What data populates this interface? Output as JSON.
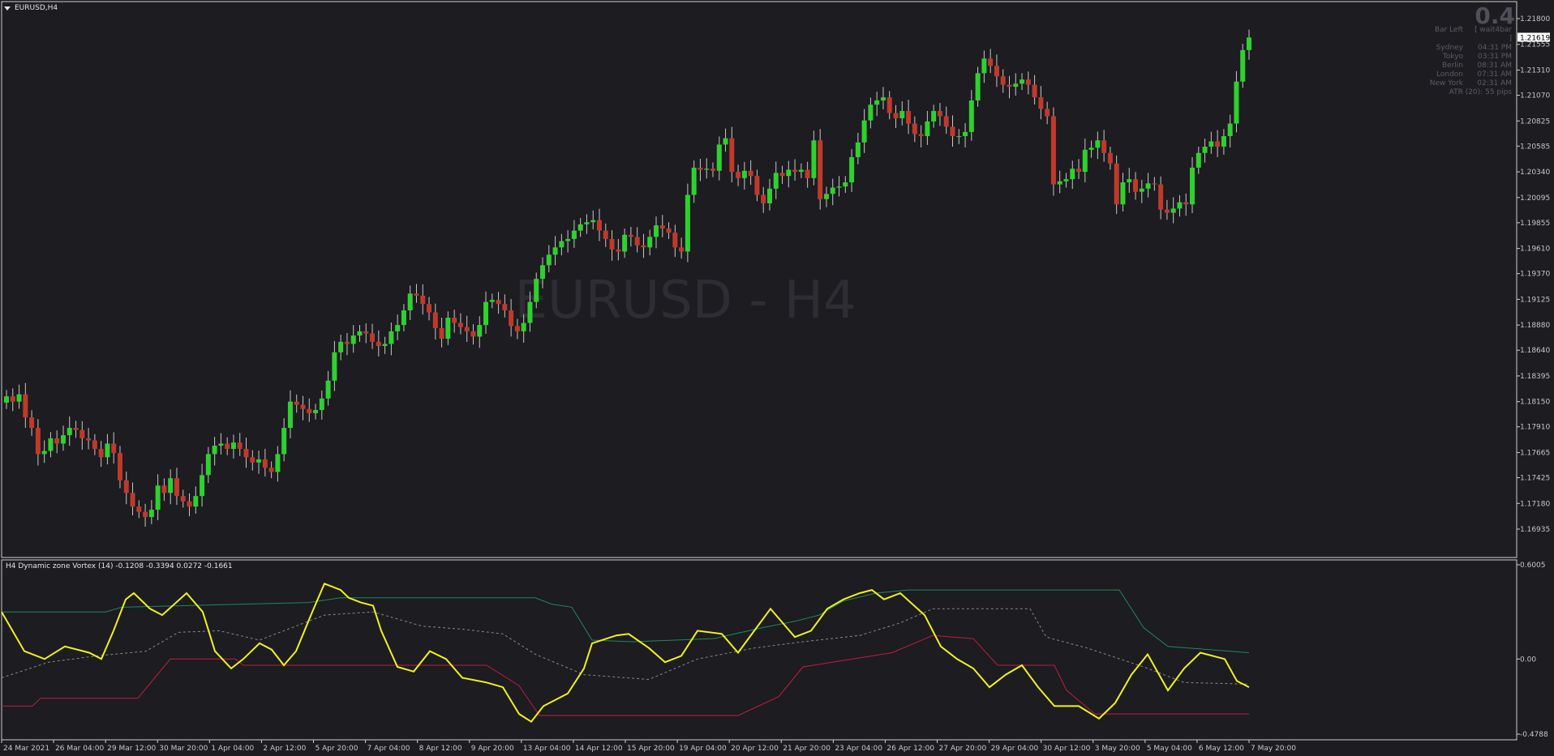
{
  "window": {
    "symbol_title": "EURUSD,H4",
    "watermark": "EURUSD - H4"
  },
  "indicator": {
    "title": "H4 Dynamic zone Vortex (14) -0.1208 -0.3394 0.0272 -0.1661"
  },
  "info_panel": {
    "big_value": "0.4",
    "rows": [
      {
        "label": "Bar Left",
        "value": "[ wait4bar ]"
      },
      {
        "label": "Sydney",
        "value": "04:31 PM"
      },
      {
        "label": "Tokyo",
        "value": "03:31 PM"
      },
      {
        "label": "Berlin",
        "value": "08:31 AM"
      },
      {
        "label": "London",
        "value": "07:31 AM"
      },
      {
        "label": "New York",
        "value": "02:31 AM"
      }
    ],
    "atr": "ATR (20): 55 pips"
  },
  "colors": {
    "background": "#1c1c21",
    "bull": "#2ed12e",
    "bear": "#c0392b",
    "vortex": "#f2f21c",
    "upper": "#1f8a5a",
    "lower": "#c21d3a",
    "mid": "#8a8a8a",
    "axis_text": "#c8c8c8"
  },
  "chart_data": [
    {
      "type": "candlestick",
      "title": "EURUSD,H4",
      "current_price_label": "1.21619",
      "y_ticks": [
        "1.21800",
        "1.21555",
        "1.21310",
        "1.21070",
        "1.20825",
        "1.20585",
        "1.20340",
        "1.20095",
        "1.19855",
        "1.19610",
        "1.19370",
        "1.19125",
        "1.18880",
        "1.18640",
        "1.18395",
        "1.18150",
        "1.17910",
        "1.17665",
        "1.17425",
        "1.17180",
        "1.16935"
      ],
      "ylim": [
        1.16935,
        1.218
      ],
      "x_ticks": [
        "24 Mar 2021",
        "26 Mar 04:00",
        "29 Mar 12:00",
        "30 Mar 20:00",
        "1 Apr 04:00",
        "2 Apr 12:00",
        "5 Apr 20:00",
        "7 Apr 04:00",
        "8 Apr 12:00",
        "9 Apr 20:00",
        "13 Apr 04:00",
        "14 Apr 12:00",
        "15 Apr 20:00",
        "19 Apr 04:00",
        "20 Apr 12:00",
        "21 Apr 20:00",
        "23 Apr 04:00",
        "26 Apr 12:00",
        "27 Apr 20:00",
        "29 Apr 04:00",
        "30 Apr 12:00",
        "3 May 20:00",
        "5 May 04:00",
        "6 May 12:00",
        "7 May 20:00"
      ],
      "close_path": [
        1.182,
        1.1815,
        1.1822,
        1.18,
        1.179,
        1.1765,
        1.1768,
        1.178,
        1.1775,
        1.1783,
        1.179,
        1.1788,
        1.178,
        1.1778,
        1.177,
        1.1762,
        1.1775,
        1.1766,
        1.174,
        1.1728,
        1.1715,
        1.171,
        1.1705,
        1.1712,
        1.1735,
        1.1728,
        1.1742,
        1.1725,
        1.172,
        1.1715,
        1.1725,
        1.1745,
        1.1765,
        1.1773,
        1.1775,
        1.177,
        1.1776,
        1.177,
        1.1762,
        1.1757,
        1.176,
        1.1752,
        1.1748,
        1.1765,
        1.179,
        1.1815,
        1.1812,
        1.1808,
        1.1804,
        1.1807,
        1.1818,
        1.1835,
        1.1862,
        1.1872,
        1.187,
        1.1878,
        1.1882,
        1.188,
        1.1872,
        1.1868,
        1.187,
        1.1882,
        1.1888,
        1.1902,
        1.1918,
        1.1916,
        1.1908,
        1.19,
        1.1885,
        1.1875,
        1.1895,
        1.189,
        1.1886,
        1.1882,
        1.1877,
        1.1888,
        1.191,
        1.1912,
        1.1908,
        1.1902,
        1.1887,
        1.1882,
        1.189,
        1.191,
        1.1932,
        1.1945,
        1.1955,
        1.1962,
        1.1968,
        1.197,
        1.1978,
        1.1984,
        1.1986,
        1.1988,
        1.1978,
        1.197,
        1.196,
        1.1958,
        1.1974,
        1.1972,
        1.1964,
        1.1962,
        1.1972,
        1.1983,
        1.198,
        1.1976,
        1.1962,
        1.1958,
        1.2012,
        1.2038,
        1.2036,
        1.2037,
        1.2035,
        1.206,
        1.2066,
        1.2034,
        1.2028,
        1.2035,
        1.203,
        1.2012,
        1.2004,
        1.2018,
        1.2033,
        1.203,
        1.2036,
        1.2034,
        1.2036,
        1.2028,
        1.2064,
        1.2008,
        1.2013,
        1.2019,
        1.202,
        1.2024,
        1.2048,
        1.2062,
        1.2083,
        1.2098,
        1.2102,
        1.2105,
        1.209,
        1.2085,
        1.2092,
        1.208,
        1.207,
        1.2068,
        1.2082,
        1.2092,
        1.2087,
        1.2077,
        1.2068,
        1.2068,
        1.2072,
        1.2102,
        1.2128,
        1.2142,
        1.2135,
        1.2125,
        1.2117,
        1.2115,
        1.2118,
        1.2122,
        1.2117,
        1.2105,
        1.2094,
        1.2087,
        1.2022,
        1.2025,
        1.2027,
        1.2037,
        1.2034,
        1.2055,
        1.2057,
        1.2064,
        1.2052,
        1.2042,
        1.2003,
        1.2024,
        1.2027,
        1.2015,
        1.2018,
        1.2023,
        1.2022,
        1.1998,
        1.1995,
        1.1999,
        1.2005,
        1.2003,
        1.2038,
        1.2052,
        1.2058,
        1.2063,
        1.2058,
        1.2068,
        1.208,
        1.212,
        1.215,
        1.2162
      ]
    },
    {
      "type": "line",
      "title": "H4 Dynamic zone Vortex (14)",
      "y_ticks": [
        "0.6005",
        "0.00",
        "-0.4788"
      ],
      "ylim": [
        -0.4788,
        0.6005
      ],
      "series": []
    }
  ],
  "axis": {
    "price_ticks": [
      "1.21800",
      "1.21555",
      "1.21310",
      "1.21070",
      "1.20825",
      "1.20585",
      "1.20340",
      "1.20095",
      "1.19855",
      "1.19610",
      "1.19370",
      "1.19125",
      "1.18880",
      "1.18640",
      "1.18395",
      "1.18150",
      "1.17910",
      "1.17665",
      "1.17425",
      "1.17180",
      "1.16935"
    ],
    "indicator_ticks": [
      "0.6005",
      "0.00",
      "-0.4788"
    ],
    "time_ticks": [
      "24 Mar 2021",
      "26 Mar 04:00",
      "29 Mar 12:00",
      "30 Mar 20:00",
      "1 Apr 04:00",
      "2 Apr 12:00",
      "5 Apr 20:00",
      "7 Apr 04:00",
      "8 Apr 12:00",
      "9 Apr 20:00",
      "13 Apr 04:00",
      "14 Apr 12:00",
      "15 Apr 20:00",
      "19 Apr 04:00",
      "20 Apr 12:00",
      "21 Apr 20:00",
      "23 Apr 04:00",
      "26 Apr 12:00",
      "27 Apr 20:00",
      "29 Apr 04:00",
      "30 Apr 12:00",
      "3 May 20:00",
      "5 May 04:00",
      "6 May 12:00",
      "7 May 20:00"
    ],
    "current_price": "1.21619"
  }
}
